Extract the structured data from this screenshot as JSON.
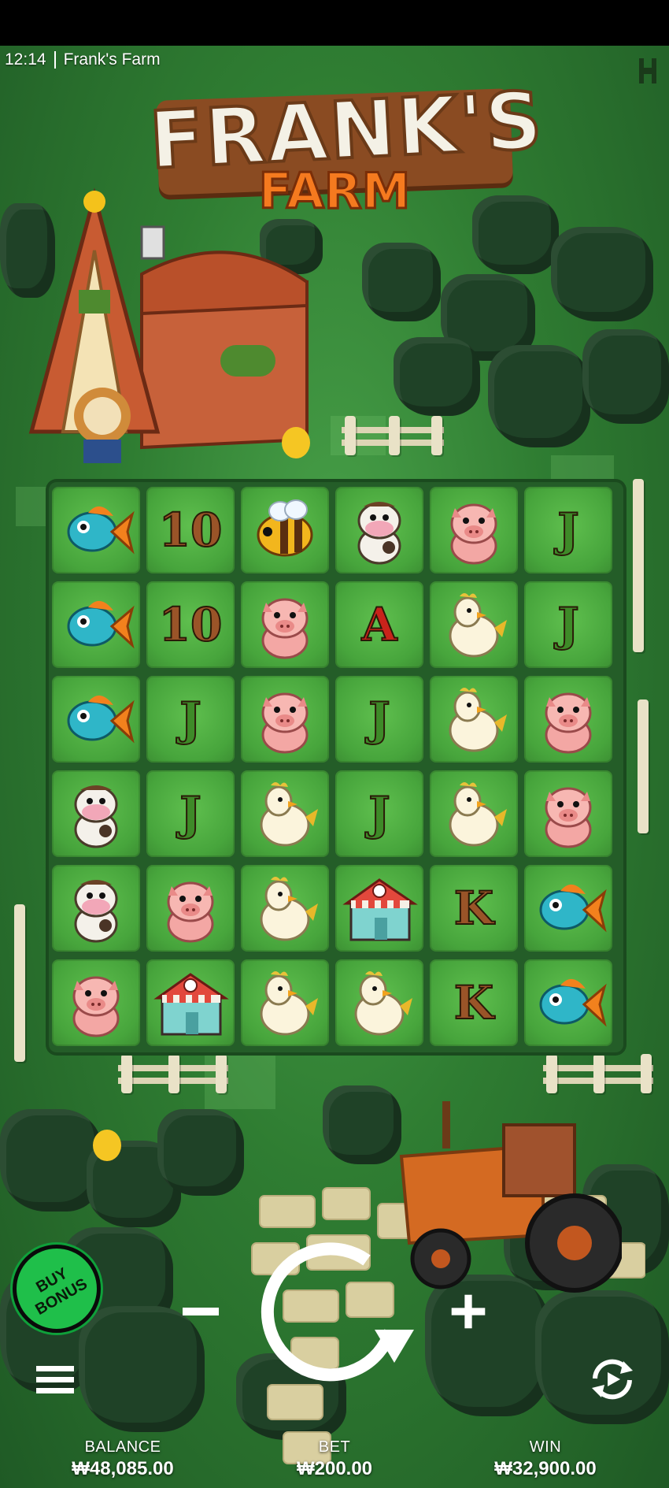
{
  "status": {
    "time": "12:14",
    "game_title": "Frank's Farm"
  },
  "logo": {
    "line1": "FRANK'S",
    "line2": "FARM"
  },
  "grid": {
    "rows": [
      [
        "fish",
        "10",
        "bee",
        "cow",
        "pig",
        "J"
      ],
      [
        "fish",
        "10",
        "pig",
        "A",
        "chicken",
        "J"
      ],
      [
        "fish",
        "J",
        "pig",
        "J",
        "chicken",
        "pig"
      ],
      [
        "cow",
        "J",
        "chicken",
        "J",
        "chicken",
        "pig"
      ],
      [
        "cow",
        "pig",
        "chicken",
        "shop",
        "K",
        "fish"
      ],
      [
        "pig",
        "shop",
        "chicken",
        "chicken",
        "K",
        "fish"
      ]
    ]
  },
  "controls": {
    "buy_bonus_label": "BUY BONUS",
    "minus_icon": "minus-icon",
    "plus_icon": "plus-icon",
    "spin_icon": "spin-arrow-icon",
    "menu_icon": "hamburger-menu-icon",
    "autoplay_icon": "autoplay-icon"
  },
  "footer": {
    "balance_label": "BALANCE",
    "balance_value": "₩48,085.00",
    "bet_label": "BET",
    "bet_value": "₩200.00",
    "win_label": "WIN",
    "win_value": "₩32,900.00"
  },
  "colors": {
    "grass": "#47a53c",
    "accent_buy": "#1fbf4a",
    "logo_orange": "#f57a1f",
    "letter_green": "#3e8a28",
    "letter_brown": "#9a5428",
    "letter_red": "#c8231b"
  }
}
